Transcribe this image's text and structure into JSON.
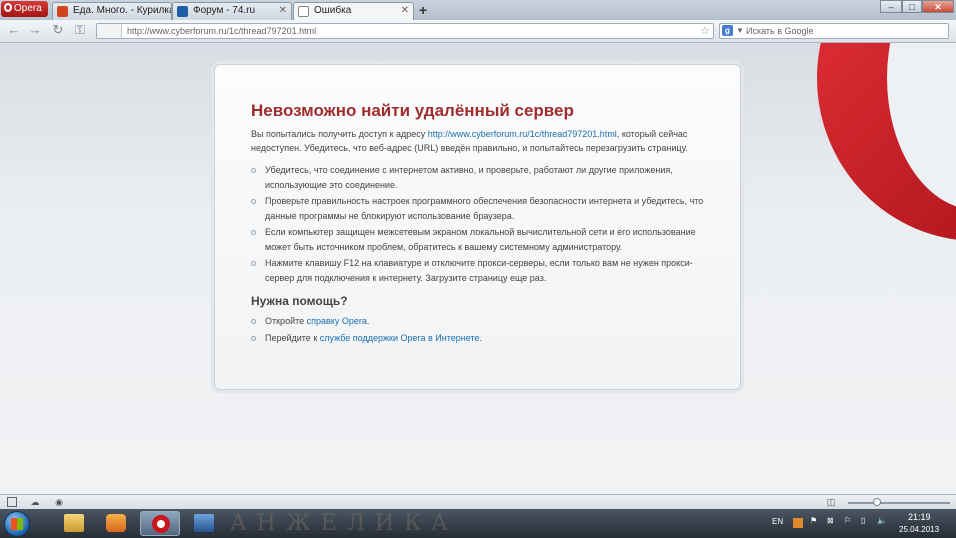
{
  "browser": {
    "menu_label": "Opera",
    "tabs": [
      {
        "label": "Еда. Много. - Курилка ...",
        "favicon_color": "#d0471e"
      },
      {
        "label": "Форум - 74.ru",
        "favicon_color": "#1f5fa8"
      },
      {
        "label": "Ошибка",
        "favicon_color": "#ffffff"
      }
    ],
    "new_tab": "+",
    "address": "http://www.cyberforum.ru/1c/thread797201.html",
    "search_placeholder": "Искать в Google",
    "search_engine_letter": "g"
  },
  "error_page": {
    "title": "Невозможно найти удалённый сервер",
    "lead_before": "Вы попытались получить доступ к адресу ",
    "lead_link": "http://www.cyberforum.ru/1c/thread797201.html",
    "lead_after": ", который сейчас недоступен. Убедитесь, что веб-адрес (URL) введён правильно, и попытайтесь перезагрузить страницу.",
    "bullets": [
      "Убедитесь, что соединение с интернетом активно, и проверьте, работают ли другие приложения, использующие это соединение.",
      "Проверьте правильность настроек программного обеспечения безопасности интернета и убедитесь, что данные программы не блокируют использование браузера.",
      "Если компьютер защищен межсетевым экраном локальной вычислительной сети и его использование может быть источником проблем, обратитесь к вашему системному администратору.",
      "Нажмите клавишу F12 на клавиатуре и отключите прокси-серверы, если только вам не нужен прокси-сервер для подключения к интернету. Загрузите страницу еще раз."
    ],
    "help_title": "Нужна помощь?",
    "help_items": [
      {
        "before": "Откройте ",
        "link": "справку Opera",
        "after": "."
      },
      {
        "before": "Перейдите к ",
        "link": "службе поддержки Opera в Интернете",
        "after": "."
      }
    ]
  },
  "taskbar": {
    "decor_text": "АНЖЕЛИКА",
    "language": "EN",
    "time": "21:19",
    "date": "25.04.2013"
  },
  "colors": {
    "title_red": "#a02d2d",
    "link_blue": "#1a6fb0",
    "opera_red": "#c8161d"
  }
}
